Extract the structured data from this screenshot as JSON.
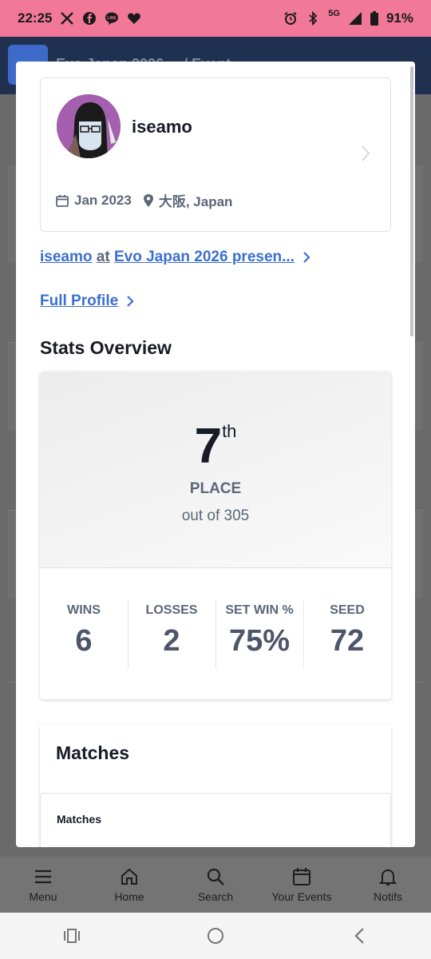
{
  "status_bar": {
    "time": "22:25",
    "network": "5G",
    "battery": "91%",
    "left_icons": [
      "x-icon",
      "facebook-icon",
      "line-icon",
      "heart-icon"
    ],
    "right_icons": [
      "alarm-icon",
      "bluetooth-icon",
      "signal-icon",
      "battery-icon"
    ]
  },
  "background": {
    "page_title": "Evo Japan 2026 ... / Event",
    "bottom_nav": [
      {
        "label": "Menu",
        "icon": "menu-icon"
      },
      {
        "label": "Home",
        "icon": "home-icon"
      },
      {
        "label": "Search",
        "icon": "search-icon"
      },
      {
        "label": "Your Events",
        "icon": "calendar-icon"
      },
      {
        "label": "Notifs",
        "icon": "bell-icon"
      }
    ]
  },
  "profile": {
    "gamertag": "iseamo",
    "joined": "Jan 2023",
    "location": "大阪, Japan"
  },
  "links": {
    "entrant_name": "iseamo",
    "entrant_at": "at",
    "entrant_event": "Evo Japan 2026 presen...",
    "full_profile": "Full Profile"
  },
  "stats": {
    "section_title": "Stats Overview",
    "placement": "7",
    "placement_suffix": "th",
    "placement_label": "PLACE",
    "out_of": "out of 305",
    "items": [
      {
        "label": "WINS",
        "value": "6"
      },
      {
        "label": "LOSSES",
        "value": "2"
      },
      {
        "label": "SET WIN %",
        "value": "75%"
      },
      {
        "label": "SEED",
        "value": "72"
      }
    ]
  },
  "matches": {
    "title": "Matches",
    "table_header": "Matches"
  },
  "colors": {
    "status_bar": "#f2789a",
    "link": "#3b6fd1",
    "text_dark": "#161b26",
    "text_muted": "#5c6678"
  }
}
